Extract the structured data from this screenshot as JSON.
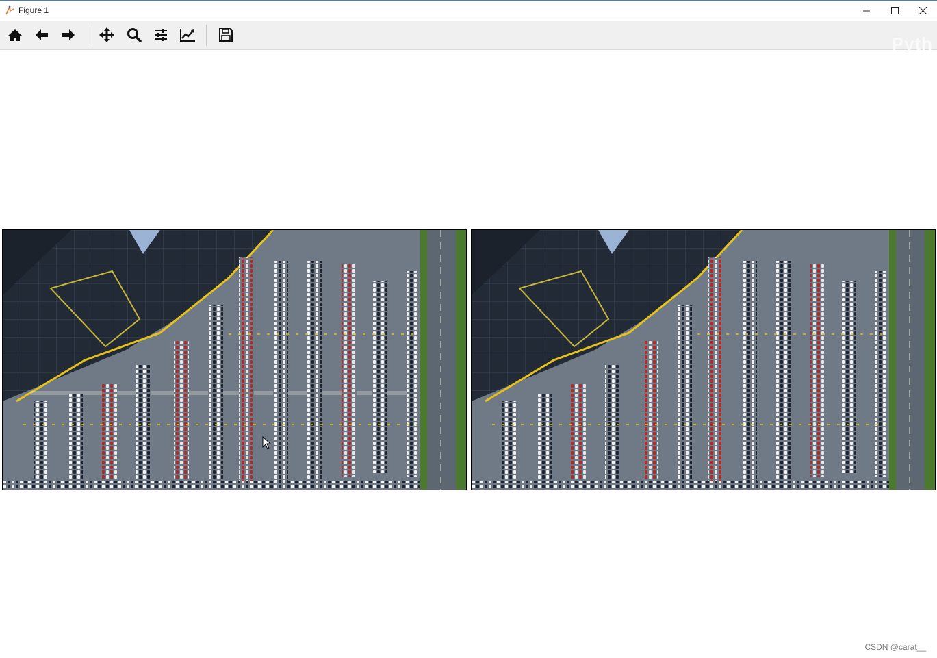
{
  "window": {
    "title": "Figure 1",
    "controls": [
      "minimize",
      "maximize",
      "close"
    ]
  },
  "toolbar": {
    "buttons": [
      {
        "name": "home",
        "icon": "home-icon"
      },
      {
        "name": "back",
        "icon": "arrow-left-icon"
      },
      {
        "name": "forward",
        "icon": "arrow-right-icon"
      },
      {
        "name": "pan",
        "icon": "move-icon"
      },
      {
        "name": "zoom",
        "icon": "magnifier-icon"
      },
      {
        "name": "configure-subplots",
        "icon": "sliders-icon"
      },
      {
        "name": "edit-axes",
        "icon": "line-chart-icon"
      },
      {
        "name": "save",
        "icon": "floppy-disk-icon"
      }
    ],
    "ghost_text": "Pyth"
  },
  "figure": {
    "panels": [
      {
        "name": "left-image",
        "content": "aerial parking lot"
      },
      {
        "name": "right-image",
        "content": "aerial parking lot"
      }
    ]
  },
  "watermark": "CSDN @carat__",
  "colors": {
    "asphalt": "#6f7a86",
    "roof": "#222a36",
    "grass": "#4b7a2e",
    "lane_line": "#e8e6d8",
    "yellow_line": "#e6c21a"
  }
}
